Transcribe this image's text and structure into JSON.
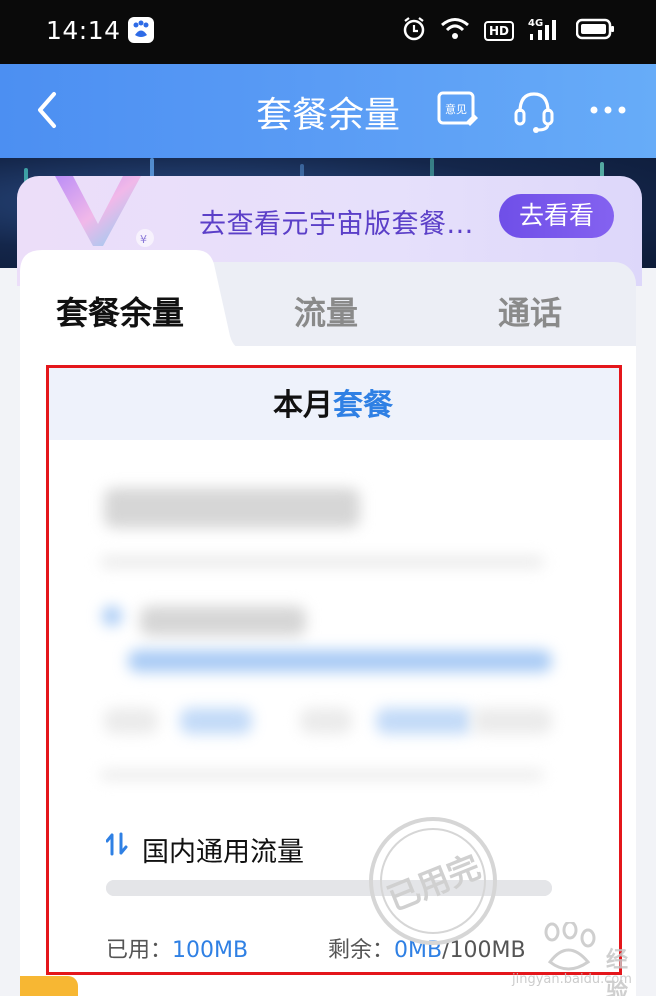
{
  "status_bar": {
    "time": "14:14",
    "hd_label": "HD",
    "network_label": "4G"
  },
  "app_bar": {
    "title": "套餐余量",
    "icons": [
      "back-arrow-icon",
      "feedback-icon",
      "headset-icon",
      "more-icon"
    ],
    "feedback_icon_text": "意见"
  },
  "promo": {
    "text": "去查看元宇宙版套餐...",
    "button_label": "去看看"
  },
  "tabs": [
    {
      "label": "套餐余量",
      "active": true
    },
    {
      "label": "流量",
      "active": false
    },
    {
      "label": "通话",
      "active": false
    }
  ],
  "card": {
    "header_prefix": "本月",
    "header_accent": "套餐",
    "usage": {
      "title": "国内通用流量",
      "used_label": "已用：",
      "used_value": "100MB",
      "remain_label": "剩余：",
      "remain_value": "0MB",
      "total": "/100MB",
      "progress_used_fraction": 1.0
    },
    "stamp_text": "已用完"
  },
  "watermark": {
    "text": "经验",
    "url": "jingyan.baidu.com"
  },
  "colors": {
    "accent": "#2f80e4",
    "highlight_border": "#e4161b",
    "promo_button": "#6f4fe8"
  }
}
